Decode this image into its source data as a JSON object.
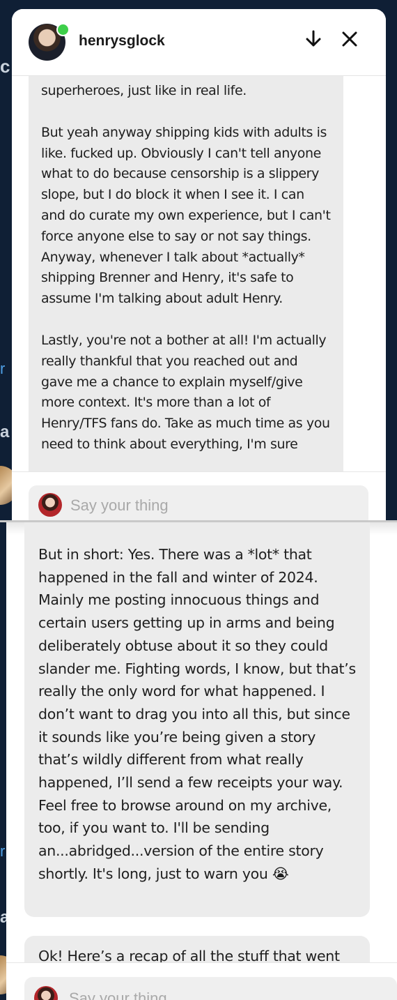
{
  "chat": {
    "username": "henrysglock",
    "header_actions": [
      "scroll-down-icon",
      "close-icon"
    ],
    "composer_placeholder": "Say your thing"
  },
  "top_message": {
    "paragraphs": [
      "superheroes, just like in real life.",
      "But yeah anyway shipping kids with adults is like. fucked up. Obviously I can't tell anyone what to do because censorship is a slippery slope, but I do block it when I see it. I can and do curate my own experience, but I can't force anyone else to say or not say things. Anyway, whenever I talk about *actually* shipping Brenner and Henry, it's safe to assume I'm talking about adult Henry.",
      "Lastly, you're not a bother at all! I'm actually really thankful that you reached out and gave me a chance to explain myself/give more context. It's more than a lot of Henry/TFS fans do. Take as much time as you need to think about everything, I'm sure"
    ]
  },
  "bottom_messages": [
    "But in short: Yes. There was a *lot* that happened in the fall and winter of 2024. Mainly me posting innocuous things and certain users getting up in arms and being deliberately obtuse about it so they could slander me. Fighting words, I know, but that’s really the only word for what happened. I don’t want to drag you into all this, but since it sounds like you’re being given a story that’s wildly different from what really happened, I’ll send a few receipts your way. Feel free to browse around on my archive, too, if you want to. I'll be sending an...abridged...version of the entire story shortly. It's long, just to warn you 😭",
    "Ok! Here’s a recap of all the stuff that went"
  ],
  "colors": {
    "background": "#0f1f35",
    "bubble": "#ececec",
    "online": "#3ecf4a",
    "placeholder": "#a9a9a9"
  }
}
